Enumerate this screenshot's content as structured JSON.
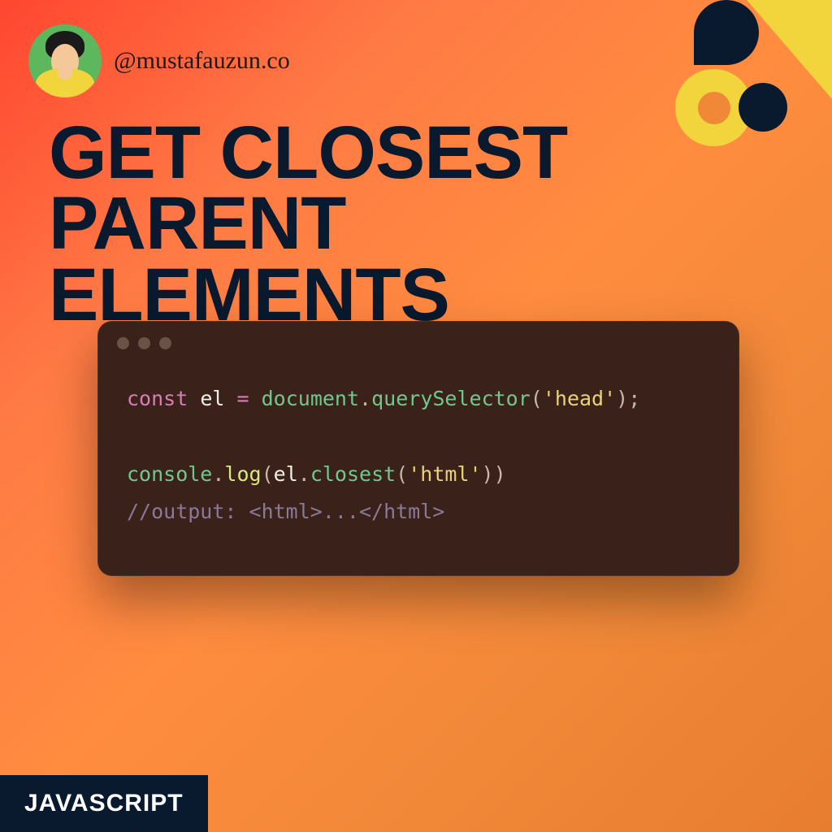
{
  "header": {
    "handle": "@mustafauzun.co"
  },
  "title_line1": "GET CLOSEST PARENT",
  "title_line2": "ELEMENTS",
  "code": {
    "line1": {
      "keyword": "const",
      "var": "el",
      "op": "=",
      "obj": "document",
      "method": "querySelector",
      "arg": "'head'"
    },
    "line2": {
      "obj": "console",
      "method": "log",
      "inner_var": "el",
      "inner_method": "closest",
      "inner_arg": "'html'"
    },
    "line3_comment": "//output: <html>...</html>"
  },
  "footer": {
    "label": "JAVASCRIPT"
  },
  "colors": {
    "accent_navy": "#09192e",
    "accent_yellow": "#f2d43c",
    "avatar_green": "#5db85d"
  }
}
